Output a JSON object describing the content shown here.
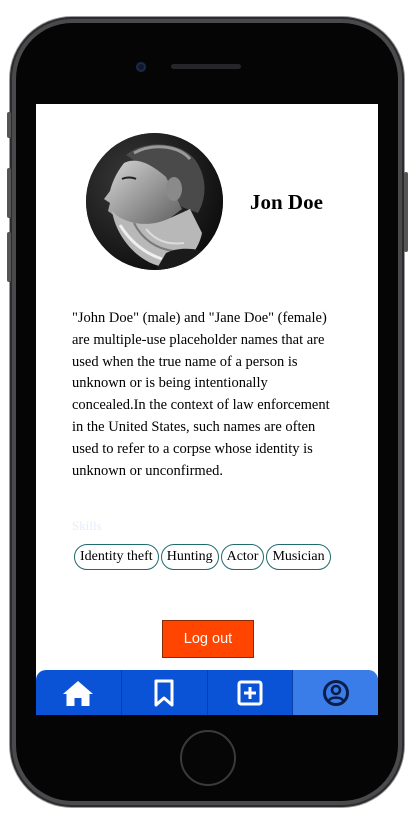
{
  "profile": {
    "name": "Jon Doe",
    "bio": "\"John Doe\" (male) and \"Jane Doe\" (female) are multiple-use placeholder names that are used when the true name of a person is unknown or is being intentionally concealed.In the context of law enforcement in the United States, such names are often used to refer to a corpse whose identity is unknown or unconfirmed.",
    "avatar_icon": "bearded-man-photo"
  },
  "skills": {
    "title": "Skills",
    "items": [
      "Identity theft",
      "Hunting",
      "Actor",
      "Musician"
    ]
  },
  "actions": {
    "logout_label": "Log out"
  },
  "nav": {
    "items": [
      {
        "name": "home",
        "icon": "home-icon",
        "active": false
      },
      {
        "name": "saved",
        "icon": "bookmark-icon",
        "active": false
      },
      {
        "name": "add",
        "icon": "plus-square-icon",
        "active": false
      },
      {
        "name": "profile",
        "icon": "user-circle-icon",
        "active": true
      }
    ]
  },
  "colors": {
    "nav_bar": "#0a53d6",
    "nav_active": "#3a7ce8",
    "logout_button": "#ff4500",
    "pill_border": "#1f6b6e"
  }
}
